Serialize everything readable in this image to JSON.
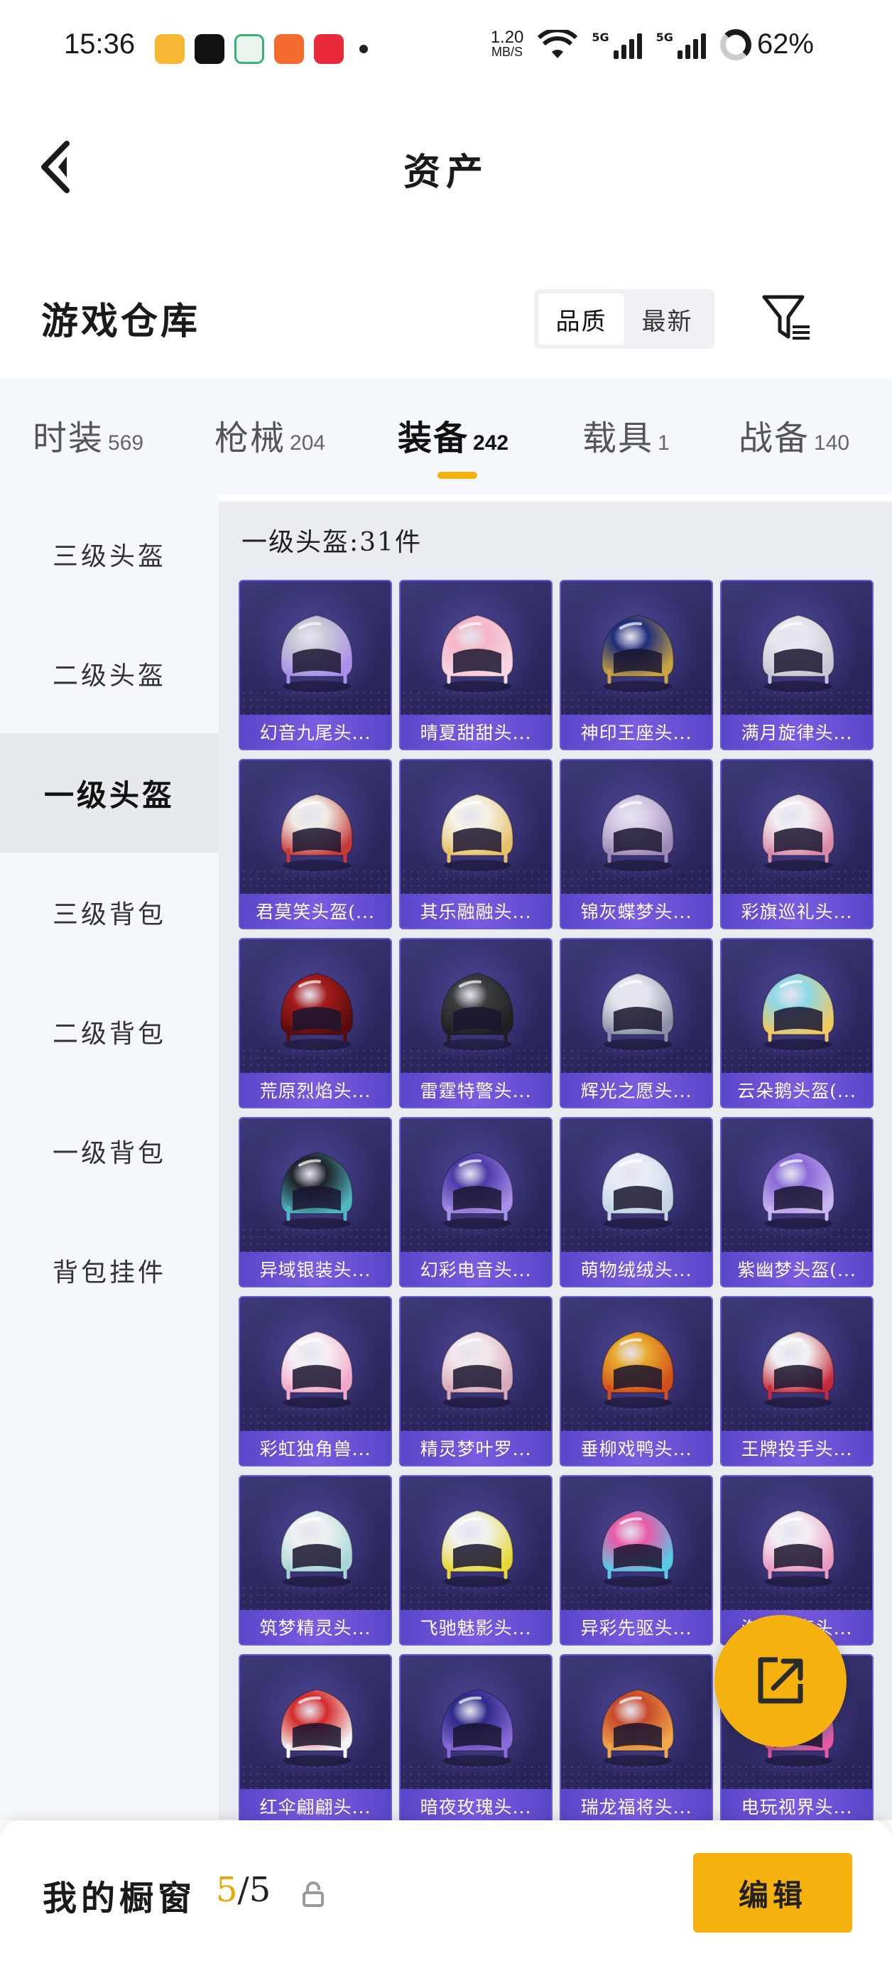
{
  "status_bar": {
    "time": "15:36",
    "net_speed_value": "1.20",
    "net_speed_unit": "MB/S",
    "signal_1": "5G",
    "signal_2": "5G",
    "battery": "62%"
  },
  "header": {
    "title": "资产"
  },
  "warehouse": {
    "title": "游戏仓库",
    "sort_options": [
      "品质",
      "最新"
    ],
    "active_sort": "品质"
  },
  "tabs": [
    {
      "label": "时装",
      "count": "569"
    },
    {
      "label": "枪械",
      "count": "204"
    },
    {
      "label": "装备",
      "count": "242",
      "active": true
    },
    {
      "label": "载具",
      "count": "1"
    },
    {
      "label": "战备",
      "count": "140"
    }
  ],
  "sidebar": {
    "items": [
      {
        "label": "三级头盔"
      },
      {
        "label": "二级头盔"
      },
      {
        "label": "一级头盔",
        "active": true
      },
      {
        "label": "三级背包"
      },
      {
        "label": "二级背包"
      },
      {
        "label": "一级背包"
      },
      {
        "label": "背包挂件"
      }
    ]
  },
  "section": {
    "heading": "一级头盔:31件"
  },
  "items": [
    {
      "name": "幻音九尾头...",
      "colors": [
        "#c9c9d6",
        "#a88fe8"
      ]
    },
    {
      "name": "晴夏甜甜头...",
      "colors": [
        "#f4b6c8",
        "#f8d6e0"
      ]
    },
    {
      "name": "神印王座头...",
      "colors": [
        "#1f2d7a",
        "#c9a443"
      ]
    },
    {
      "name": "满月旋律头...",
      "colors": [
        "#e8e6ee",
        "#c9c6d4"
      ]
    },
    {
      "name": "君莫笑头盔(...",
      "colors": [
        "#f0ece6",
        "#c23a3a"
      ]
    },
    {
      "name": "其乐融融头...",
      "colors": [
        "#f6f2e6",
        "#e6c06a"
      ]
    },
    {
      "name": "锦灰蝶梦头...",
      "colors": [
        "#d9cde8",
        "#9d8ab8"
      ]
    },
    {
      "name": "彩旗巡礼头...",
      "colors": [
        "#f2eef2",
        "#d98aa8"
      ]
    },
    {
      "name": "荒原烈焰头...",
      "colors": [
        "#a31c1c",
        "#5a0c0c"
      ]
    },
    {
      "name": "雷霆特警头...",
      "colors": [
        "#3b3d3f",
        "#1f2022"
      ]
    },
    {
      "name": "辉光之愿头...",
      "colors": [
        "#e4e6ee",
        "#8a8fa6"
      ]
    },
    {
      "name": "云朵鹅头盔(...",
      "colors": [
        "#8fd8e8",
        "#f0c860"
      ]
    },
    {
      "name": "异域银装头...",
      "colors": [
        "#1e2228",
        "#4fb6c2"
      ]
    },
    {
      "name": "幻彩电音头...",
      "colors": [
        "#4c3aa8",
        "#a88fe8"
      ]
    },
    {
      "name": "萌物绒绒头...",
      "colors": [
        "#e9eef6",
        "#c4d2e6"
      ]
    },
    {
      "name": "紫幽梦头盔(...",
      "colors": [
        "#8a6ad8",
        "#c9b6f0"
      ]
    },
    {
      "name": "彩虹独角兽...",
      "colors": [
        "#f6f0f6",
        "#f0a8c8"
      ]
    },
    {
      "name": "精灵梦叶罗...",
      "colors": [
        "#f4e8ec",
        "#d6a8b8"
      ]
    },
    {
      "name": "垂柳戏鸭头...",
      "colors": [
        "#e8a82a",
        "#d14e1c"
      ]
    },
    {
      "name": "王牌投手头...",
      "colors": [
        "#f2f2f4",
        "#c42a3a"
      ]
    },
    {
      "name": "筑梦精灵头...",
      "colors": [
        "#eef2f2",
        "#a8d6d6"
      ]
    },
    {
      "name": "飞驰魅影头...",
      "colors": [
        "#f2f2f0",
        "#e6d83a"
      ]
    },
    {
      "name": "异彩先驱头...",
      "colors": [
        "#e85aa8",
        "#5ac8e8"
      ]
    },
    {
      "name": "海洋漂亮头...",
      "colors": [
        "#f4eef4",
        "#e89ac0"
      ]
    },
    {
      "name": "红伞翩翩头...",
      "colors": [
        "#d42a2a",
        "#f4f4f4"
      ]
    },
    {
      "name": "暗夜玫瑰头...",
      "colors": [
        "#2e2a8a",
        "#8a6ad8"
      ]
    },
    {
      "name": "瑞龙福将头...",
      "colors": [
        "#c84a2a",
        "#f0a84a"
      ]
    },
    {
      "name": "电玩视界头...",
      "colors": [
        "#5ac8e8",
        "#e85aa8"
      ]
    }
  ],
  "bottom_bar": {
    "label": "我的橱窗",
    "count_current": "5",
    "count_sep": "/5",
    "edit_label": "编辑"
  },
  "icons": {
    "back": "back-arrow-icon",
    "filter": "filter-icon",
    "share": "share-icon",
    "lock": "lock-icon"
  },
  "accent_color": "#f5b20f"
}
